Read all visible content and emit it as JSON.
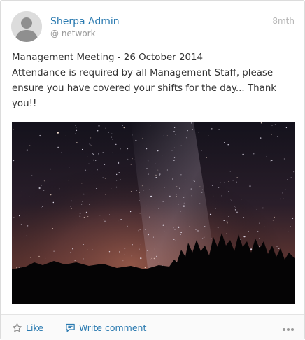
{
  "post": {
    "author": "Sherpa Admin",
    "network": "@ network",
    "timestamp": "8mth",
    "lines": [
      "Management Meeting - 26 October 2014",
      "Attendance is required by all Management Staff, please ensure you have covered your shifts for the day... Thank you!!"
    ],
    "image_icon": "night-sky-photo"
  },
  "actions": {
    "like_label": "Like",
    "comment_label": "Write comment",
    "like_icon": "star-outline-icon",
    "comment_icon": "comment-icon",
    "more_icon": "more-dots-icon"
  },
  "colors": {
    "link": "#2a7ab0",
    "muted": "#9a9a9a",
    "border": "#dcdcdc"
  }
}
